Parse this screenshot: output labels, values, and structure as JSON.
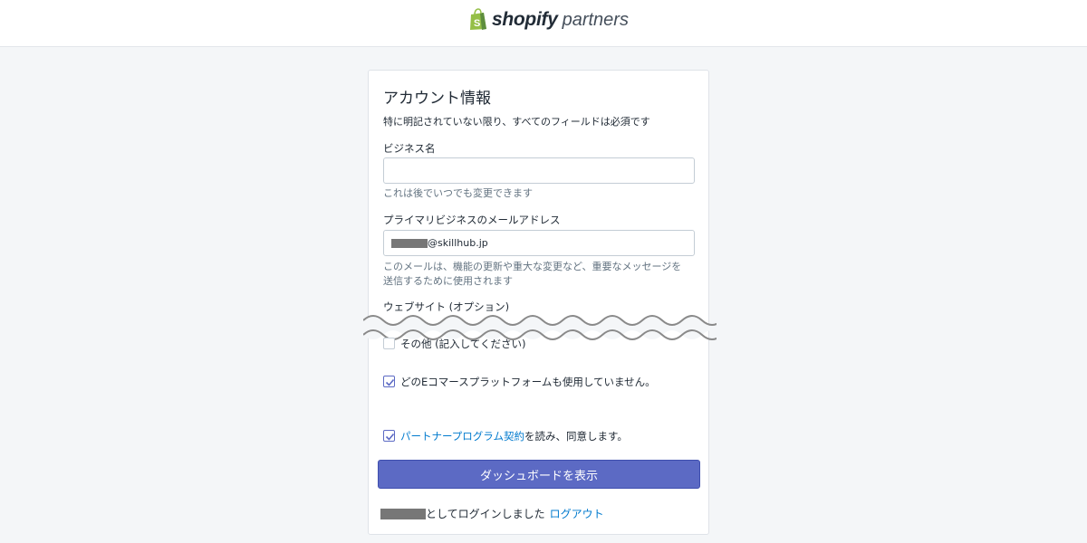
{
  "header": {
    "brand": "shopify",
    "suffix": "partners",
    "logo_icon": "shopping-bag-icon"
  },
  "form": {
    "title": "アカウント情報",
    "required_note": "特に明記されていない限り、すべてのフィールドは必須です",
    "business_name": {
      "label": "ビジネス名",
      "value": "",
      "help": "これは後でいつでも変更できます"
    },
    "email": {
      "label": "プライマリビジネスのメールアドレス",
      "value_suffix": "@skillhub.jp",
      "help_line1": "このメールは、機能の更新や重大な変更など、重要なメッセージを",
      "help_line2": "送信するために使用されます"
    },
    "website": {
      "label": "ウェブサイト (オプション)"
    },
    "options": [
      {
        "label": "その他 (記入してください)",
        "checked": false
      },
      {
        "label": "どのEコマースプラットフォームも使用していません。",
        "checked": true
      }
    ],
    "agreement": {
      "checked": true,
      "link_text": "パートナープログラム契約",
      "rest_text": "を読み、同意します。"
    },
    "submit_label": "ダッシュボードを表示",
    "login_text": "としてログインしました",
    "logout_label": "ログアウト"
  },
  "colors": {
    "accent": "#5c6ac4",
    "link": "#007ace",
    "background": "#f4f6f8"
  }
}
